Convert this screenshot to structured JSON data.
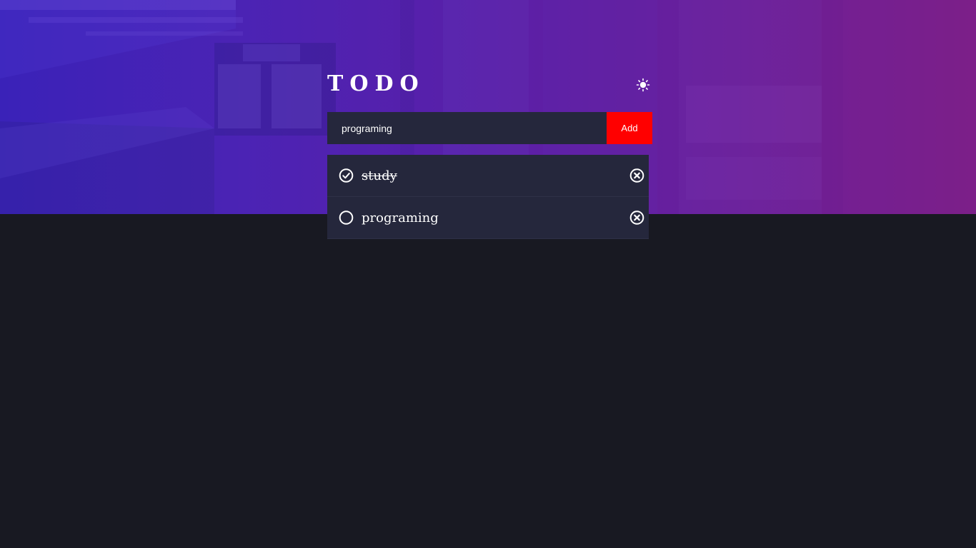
{
  "header": {
    "title": "TODO",
    "theme_icon": "sun-icon"
  },
  "form": {
    "input_value": "programing",
    "input_placeholder": "",
    "add_label": "Add",
    "add_color": "#ff0000"
  },
  "todos": [
    {
      "text": "study",
      "completed": true
    },
    {
      "text": "programing",
      "completed": false
    }
  ],
  "icons": {
    "check": "circle-check-icon",
    "unchecked": "circle-icon",
    "remove": "circle-x-icon"
  },
  "colors": {
    "background": "#181922",
    "card": "#25273c",
    "accent": "#ff0000",
    "hero_start": "#3a22b8",
    "hero_end": "#7a1d86"
  }
}
